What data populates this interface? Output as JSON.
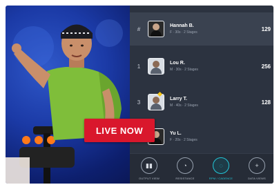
{
  "live_badge": "LIVE NOW",
  "leaderboard": {
    "rows": [
      {
        "rank": "#",
        "name": "Hannah B.",
        "meta": "F · 30s · 2 Stages",
        "score": "129",
        "highlight": true
      },
      {
        "rank": "1",
        "name": "Lou R.",
        "meta": "M · 30s · 2 Stages",
        "score": "256",
        "highlight": false
      },
      {
        "rank": "3",
        "name": "Larry T.",
        "meta": "M · 40s · 2 Stages",
        "score": "128",
        "highlight": false
      },
      {
        "rank": "",
        "name": "Yu L.",
        "meta": "F · 20s · 2 Stages",
        "score": "",
        "highlight": false
      }
    ]
  },
  "controls": [
    {
      "label": "OUTPUT VIEW",
      "icon": "bars-icon",
      "glyph": "▮▮"
    },
    {
      "label": "RESISTANCE",
      "icon": "gauge-icon",
      "glyph": "◔"
    },
    {
      "label": "RPM / CADENCE",
      "icon": "cadence-icon",
      "glyph": "◌"
    },
    {
      "label": "DATA VIEWS",
      "icon": "plus-icon",
      "glyph": "+"
    }
  ],
  "colors": {
    "live_red": "#d9172c",
    "panel_bg": "#2c3340",
    "accent_teal": "#23c7d9",
    "video_blue": "#1b3aa6"
  }
}
